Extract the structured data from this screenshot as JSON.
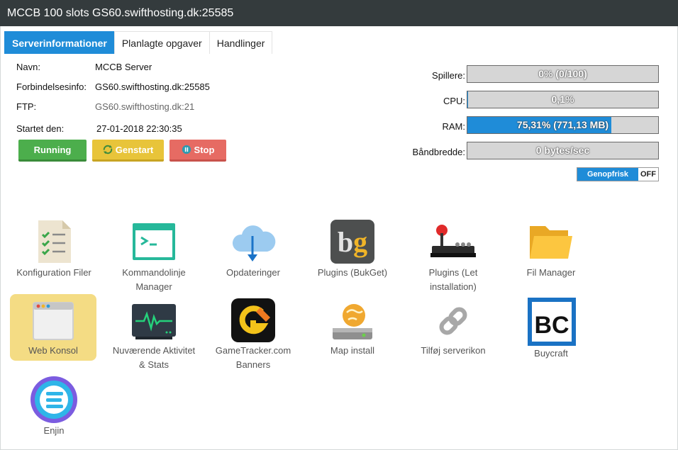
{
  "window": {
    "title": "MCCB 100 slots GS60.swifthosting.dk:25585"
  },
  "tabs": [
    {
      "label": "Serverinformationer",
      "active": true
    },
    {
      "label": "Planlagte opgaver",
      "active": false
    },
    {
      "label": "Handlinger",
      "active": false
    }
  ],
  "info": {
    "name_label": "Navn:",
    "name_value": "MCCB Server",
    "connection_label": "Forbindelsesinfo:",
    "connection_value": "GS60.swifthosting.dk:25585",
    "ftp_label": "FTP:",
    "ftp_value": "GS60.swifthosting.dk:21",
    "started_label": "Startet den:",
    "started_value": "27-01-2018 22:30:35"
  },
  "buttons": {
    "running": "Running",
    "restart": "Genstart",
    "stop": "Stop"
  },
  "stats": {
    "players_label": "Spillere:",
    "players_text": "0% (0/100)",
    "players_fraction": 0,
    "cpu_label": "CPU:",
    "cpu_text": "0,1%",
    "cpu_fraction": 0.001,
    "ram_label": "RAM:",
    "ram_text": "75,31% (771,13 MB)",
    "ram_fraction": 0.7531,
    "bandwidth_label": "Båndbredde:",
    "bandwidth_text": "0 bytes/sec",
    "bandwidth_fraction": 0
  },
  "refresh_toggle": {
    "on_label": "Genopfrisk",
    "off_label": "OFF"
  },
  "tiles": {
    "config_files": "Konfiguration Filer",
    "cmd_manager": "Kommandolinje Manager",
    "updates": "Opdateringer",
    "plugins_bukget": "Plugins (BukGet)",
    "plugins_easy": "Plugins (Let installation)",
    "file_manager": "Fil Manager",
    "web_console": "Web Konsol",
    "activity_stats": "Nuværende Aktivitet & Stats",
    "gametracker": "GameTracker.com Banners",
    "map_install": "Map install",
    "server_icon": "Tilføj serverikon",
    "buycraft": "Buycraft",
    "enjin": "Enjin"
  },
  "colors": {
    "accent": "#1f8cd8",
    "titlebar": "#343b3d",
    "running": "#4cae4c",
    "restart": "#e8c43a",
    "stop": "#e66b63",
    "highlight": "#f4dc84"
  }
}
